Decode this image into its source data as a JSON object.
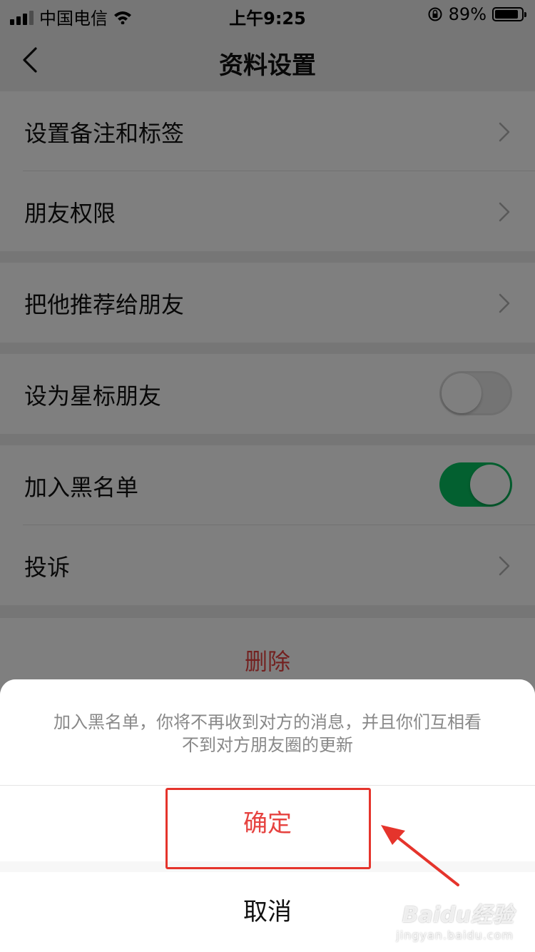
{
  "status_bar": {
    "carrier": "中国电信",
    "time": "上午9:25",
    "battery": "89%",
    "battery_level": 0.89,
    "icons": [
      "signal-icon",
      "wifi-icon",
      "rotation-lock-icon",
      "battery-icon"
    ]
  },
  "nav": {
    "back_icon": "back-chevron-icon",
    "title": "资料设置"
  },
  "groups": [
    {
      "rows": [
        {
          "label": "设置备注和标签",
          "type": "link"
        },
        {
          "label": "朋友权限",
          "type": "link"
        }
      ]
    },
    {
      "rows": [
        {
          "label": "把他推荐给朋友",
          "type": "link"
        }
      ]
    },
    {
      "rows": [
        {
          "label": "设为星标朋友",
          "type": "toggle",
          "value": false
        }
      ]
    },
    {
      "rows": [
        {
          "label": "加入黑名单",
          "type": "toggle",
          "value": true
        },
        {
          "label": "投诉",
          "type": "link"
        }
      ]
    }
  ],
  "delete_label": "删除",
  "action_sheet": {
    "message_line1": "加入黑名单，你将不再收到对方的消息，并且你们互相看",
    "message_line2": "不到对方朋友圈的更新",
    "confirm_label": "确定",
    "cancel_label": "取消"
  },
  "colors": {
    "accent_green": "#07c160",
    "danger_red": "#e64340",
    "annotation_red": "#e5342c"
  },
  "watermark": {
    "main": "Baidu经验",
    "sub": "jingyan.baidu.com"
  }
}
